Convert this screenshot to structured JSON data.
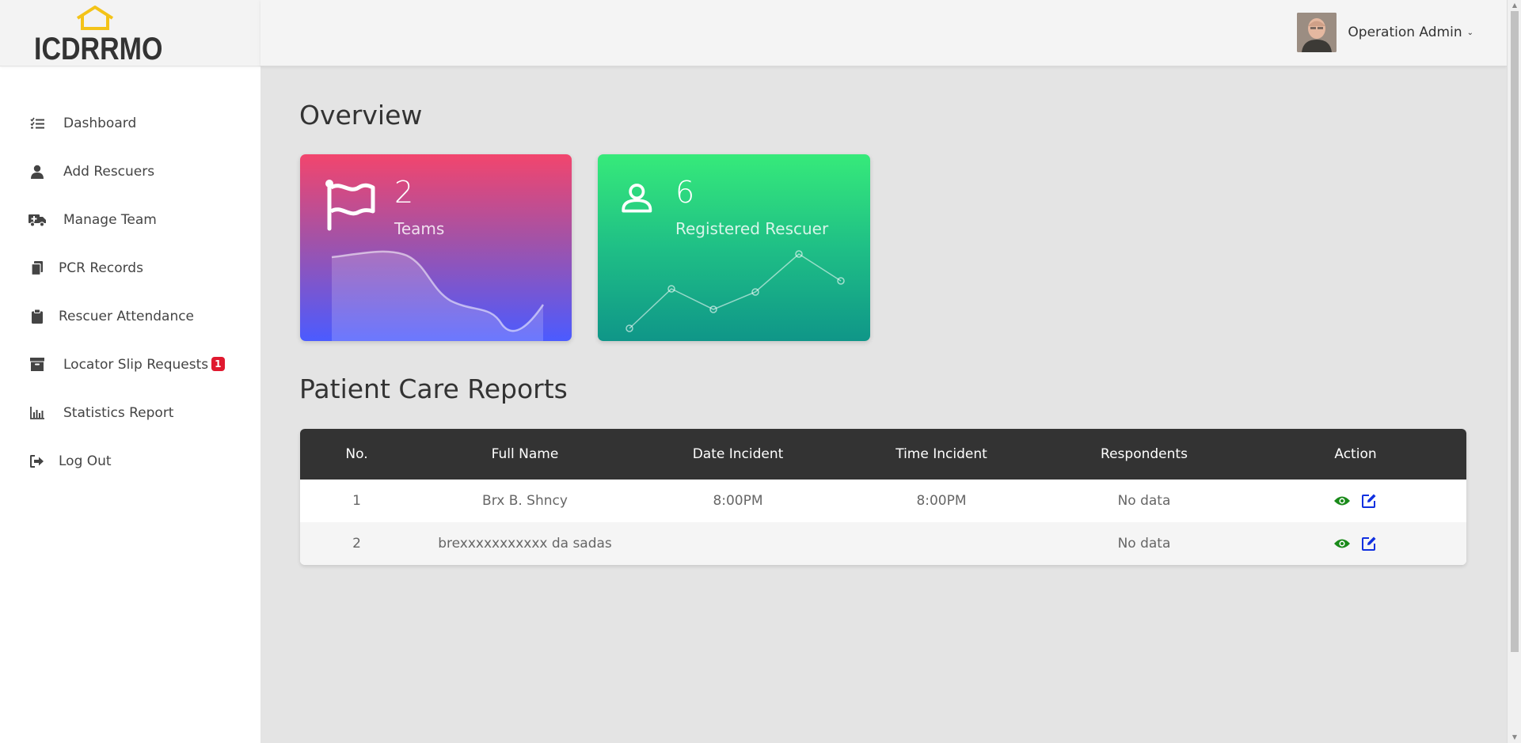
{
  "brand": {
    "name": "ICDRRMO"
  },
  "sidebar": {
    "items": [
      {
        "label": "Dashboard",
        "icon": "list-check-icon"
      },
      {
        "label": "Add Rescuers",
        "icon": "user-icon"
      },
      {
        "label": "Manage Team",
        "icon": "ambulance-icon"
      },
      {
        "label": "PCR Records",
        "icon": "files-icon"
      },
      {
        "label": "Rescuer Attendance",
        "icon": "clipboard-icon"
      },
      {
        "label": "Locator Slip Requests",
        "icon": "archive-icon",
        "badge": "1"
      },
      {
        "label": "Statistics Report",
        "icon": "bar-chart-icon"
      },
      {
        "label": "Log Out",
        "icon": "sign-out-icon"
      }
    ]
  },
  "header": {
    "user_name": "Operation Admin"
  },
  "overview": {
    "title": "Overview",
    "cards": [
      {
        "value": "2",
        "label": "Teams",
        "icon": "flag-icon",
        "colors": [
          "#f2456d",
          "#4b5bff"
        ]
      },
      {
        "value": "6",
        "label": "Registered Rescuer",
        "icon": "user-outline-icon",
        "colors": [
          "#36ea7a",
          "#0f9688"
        ]
      }
    ]
  },
  "pcr": {
    "title": "Patient Care Reports",
    "columns": [
      "No.",
      "Full Name",
      "Date Incident",
      "Time Incident",
      "Respondents",
      "Action"
    ],
    "rows": [
      {
        "no": "1",
        "full_name": "Brx B. Shncy",
        "date_incident": "8:00PM",
        "time_incident": "8:00PM",
        "respondents": "No data"
      },
      {
        "no": "2",
        "full_name": "brexxxxxxxxxxx da sadas",
        "date_incident": "",
        "time_incident": "",
        "respondents": "No data"
      }
    ],
    "action_colors": {
      "view": "#1a8a1a",
      "edit": "#1030e0"
    }
  }
}
